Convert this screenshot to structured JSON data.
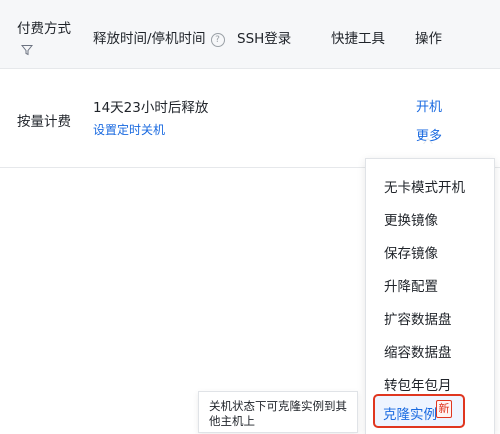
{
  "table": {
    "headers": {
      "billing": "付费方式",
      "release_time": "释放时间/停机时间",
      "ssh": "SSH登录",
      "tools": "快捷工具",
      "actions": "操作"
    },
    "help_glyph": "?",
    "row": {
      "billing": "按量计费",
      "release_text": "14天23小时后释放",
      "schedule_link": "设置定时关机",
      "start_link": "开机",
      "more_link": "更多"
    }
  },
  "menu": {
    "items": [
      "无卡模式开机",
      "更换镜像",
      "保存镜像",
      "升降配置",
      "扩容数据盘",
      "缩容数据盘",
      "转包年包月"
    ],
    "clone_label": "克隆实例",
    "new_badge": "新"
  },
  "tooltip": {
    "text": "关机状态下可克隆实例到其他主机上"
  },
  "colors": {
    "link": "#1a6ae0",
    "highlight": "#e0361f",
    "header_bg": "#f6f7f9"
  }
}
